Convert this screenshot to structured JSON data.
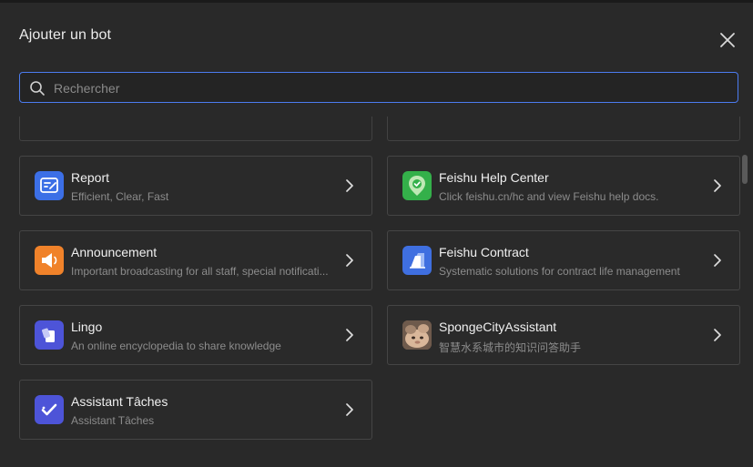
{
  "dialog": {
    "title": "Ajouter un bot",
    "search": {
      "placeholder": "Rechercher",
      "value": ""
    }
  },
  "bots": [
    {
      "name": "Report",
      "desc": "Efficient, Clear, Fast",
      "icon": "report-icon",
      "color": "#3c6fe6"
    },
    {
      "name": "Feishu Help Center",
      "desc": "Click feishu.cn/hc and view Feishu help docs.",
      "icon": "help-center-icon",
      "color": "#34b04a"
    },
    {
      "name": "Announcement",
      "desc": "Important broadcasting for all staff, special notificati...",
      "icon": "megaphone-icon",
      "color": "#f0822a"
    },
    {
      "name": "Feishu Contract",
      "desc": "Systematic solutions for contract life management",
      "icon": "contract-icon",
      "color": "#3f6fe0"
    },
    {
      "name": "Lingo",
      "desc": "An online encyclopedia to share knowledge",
      "icon": "lingo-icon",
      "color": "#4d54d8"
    },
    {
      "name": "SpongeCityAssistant",
      "desc": "智慧水系城市的知识问答助手",
      "icon": "avatar-photo-icon",
      "color": "#8a6a55"
    },
    {
      "name": "Assistant Tâches",
      "desc": "Assistant Tâches",
      "icon": "tasks-icon",
      "color": "#4d54d8"
    }
  ]
}
